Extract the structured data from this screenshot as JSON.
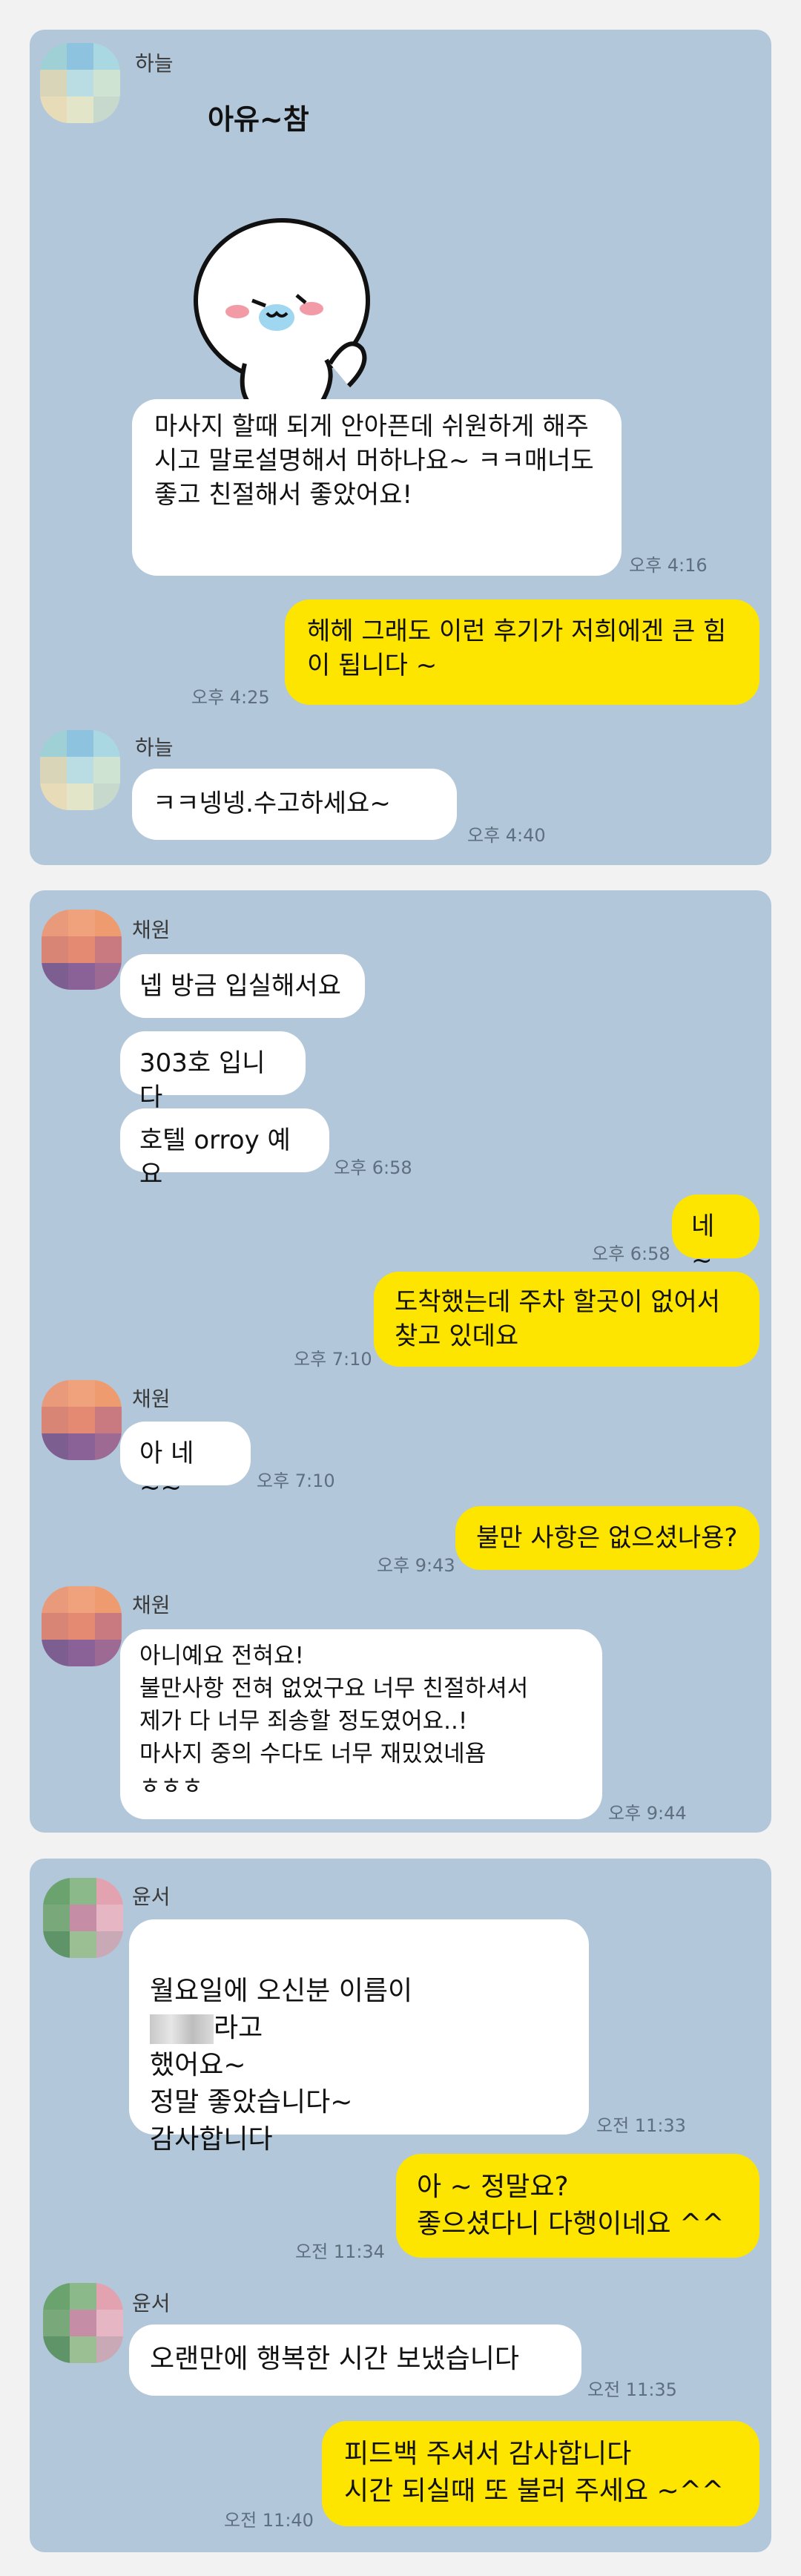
{
  "chat1": {
    "sender": "하늘",
    "sticker_text": "아유~참",
    "msg1": "마사지 할때 되게 안아픈데 쉬원하게 해주시고 말로설명해서 머하나요~ ㅋㅋ매너도 좋고 친절해서 좋았어요!",
    "time1": "오후 4:16",
    "reply1": "헤헤 그래도 이런 후기가 저희에겐 큰 힘이 됩니다 ~",
    "reply1_time": "오후 4:25",
    "sender2": "하늘",
    "msg2": "ㅋㅋ넹넹.수고하세요~",
    "time2": "오후 4:40"
  },
  "chat2": {
    "sender": "채원",
    "msg1": "넵 방금 입실해서요",
    "msg2": "303호 입니다",
    "msg3": "호텔 orroy 예요",
    "time1": "오후 6:58",
    "reply1": "네 ~",
    "reply1_time": "오후 6:58",
    "reply2": "도착했는데  주차 할곳이 없어서 찾고 있데요",
    "reply2_time": "오후 7:10",
    "sender2": "채원",
    "msg4": "아 네~~",
    "time2": "오후 7:10",
    "reply3": "불만 사항은 없으셨나용?",
    "reply3_time": "오후 9:43",
    "sender3": "채원",
    "msg5": "아니예요 전혀요!\n불만사항 전혀 없었구요 너무 친절하셔서\n제가 다 너무 죄송할 정도였어요..!\n마사지 중의 수다도 너무 재밌었네욤\nㅎㅎㅎ",
    "time3": "오후 9:44"
  },
  "chat3": {
    "sender": "윤서",
    "msg1a": "월요일에 오신분 이름이",
    "msg1b": "라고\n했어요~\n정말 좋았습니다~\n감사합니다",
    "time1": "오전 11:33",
    "reply1": "아 ~ 정말요?\n좋으셨다니 다행이네요 ^^",
    "reply1_time": "오전 11:34",
    "sender2": "윤서",
    "msg2": "오랜만에 행복한 시간 보냈습니다",
    "time2": "오전 11:35",
    "reply2": "피드백 주셔서 감사합니다\n시간 되실때 또 불러 주세요 ~^^",
    "reply2_time": "오전 11:40"
  },
  "colors": {
    "chat_bg": "#b2c7da",
    "incoming": "#ffffff",
    "outgoing": "#fee500"
  }
}
